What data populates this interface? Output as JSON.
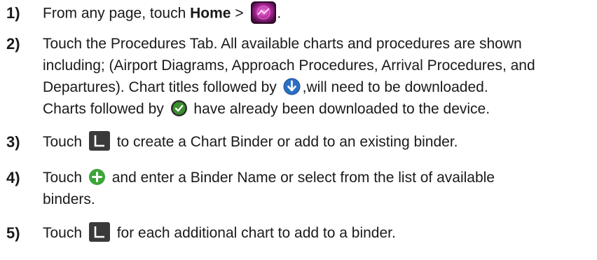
{
  "steps": [
    {
      "number": "1)",
      "line1_before": "From any page, touch ",
      "line1_bold": "Home",
      "line1_after_bold": " > ",
      "line1_end": "."
    },
    {
      "number": "2)",
      "line1": "Touch the Procedures Tab.  All available charts and procedures are shown",
      "line2": "including; (Airport Diagrams, Approach Procedures, Arrival Procedures, and",
      "line3_before": "Departures).  Chart titles followed by ",
      "line3_after": ",will need to be downloaded.",
      "line4_before": "Charts followed by ",
      "line4_after": " have already been downloaded to the device."
    },
    {
      "number": "3)",
      "line1_before": "Touch ",
      "line1_after": " to create a Chart Binder or add to an existing binder."
    },
    {
      "number": "4)",
      "line1_before": "Touch ",
      "line1_after": " and enter a Binder Name or select from the list of available",
      "line2": "binders."
    },
    {
      "number": "5)",
      "line1_before": "Touch ",
      "line1_after": " for each additional chart to add to a binder."
    }
  ],
  "icons": {
    "charts_app": "charts-app-icon",
    "download": "download-arrow-icon",
    "downloaded": "downloaded-check-icon",
    "binder": "binder-icon",
    "add": "add-plus-icon"
  },
  "colors": {
    "text": "#1a1a1a",
    "app_icon": "#b0299c",
    "download_icon": "#2b6fc4",
    "downloaded_icon": "#3a8f2e",
    "binder_icon": "#3a3a3a",
    "add_icon": "#3ea53a"
  }
}
